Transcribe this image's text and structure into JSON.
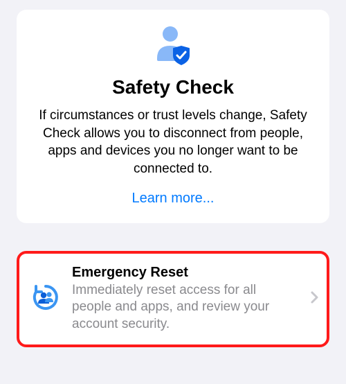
{
  "safety_check": {
    "title": "Safety Check",
    "description": "If circumstances or trust levels change, Safety Check allows you to disconnect from people, apps and devices you no longer want to be connected to.",
    "learn_more_label": "Learn more..."
  },
  "emergency_reset": {
    "title": "Emergency Reset",
    "description": "Immediately reset access for all people and apps, and review your account security."
  }
}
